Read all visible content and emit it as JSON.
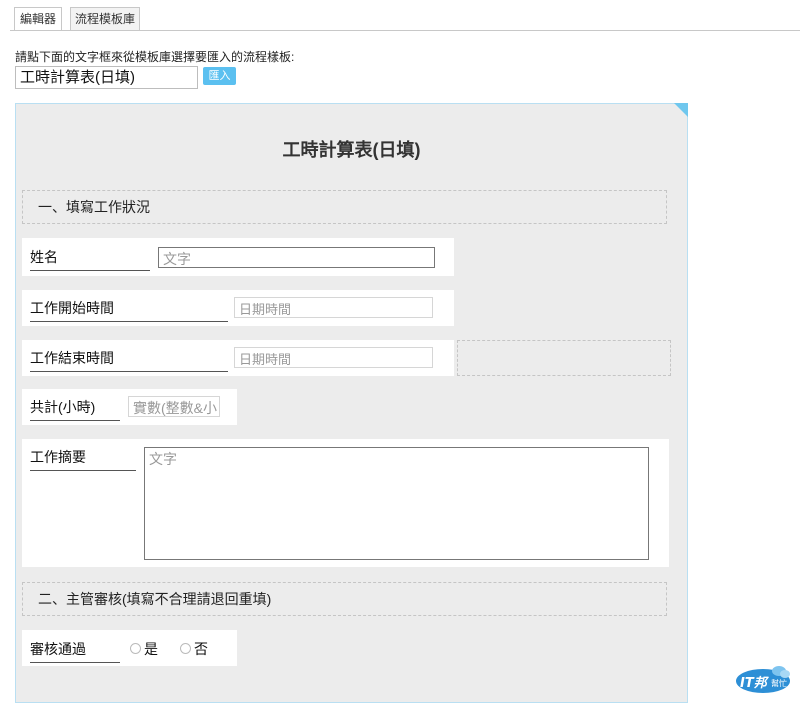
{
  "tabs": [
    {
      "label": "編輯器",
      "active": false
    },
    {
      "label": "流程模板庫",
      "active": true
    }
  ],
  "intro": {
    "instruction": "請點下面的文字框來從模板庫選擇要匯入的流程樣板:",
    "template_value": "工時計算表(日填)",
    "import_label": "匯入"
  },
  "form": {
    "title": "工時計算表(日填)",
    "section1": "一、填寫工作狀況",
    "section2": "二、主管審核(填寫不合理請退回重填)",
    "fields": {
      "name": {
        "label": "姓名",
        "placeholder": "文字"
      },
      "start": {
        "label": "工作開始時間",
        "placeholder": "日期時間"
      },
      "end": {
        "label": "工作結束時間",
        "placeholder": "日期時間"
      },
      "total": {
        "label": "共計(小時)",
        "placeholder": "實數(整數&小"
      },
      "summary": {
        "label": "工作摘要",
        "placeholder": "文字"
      },
      "review": {
        "label": "審核通過",
        "options": [
          "是",
          "否"
        ]
      }
    }
  },
  "colors": {
    "accent": "#5bc0f0",
    "panel_bg": "#ececec",
    "corner": "#6fc7ee"
  },
  "watermark": {
    "logo_text": "IT邦",
    "sub_text": "幫忙"
  }
}
